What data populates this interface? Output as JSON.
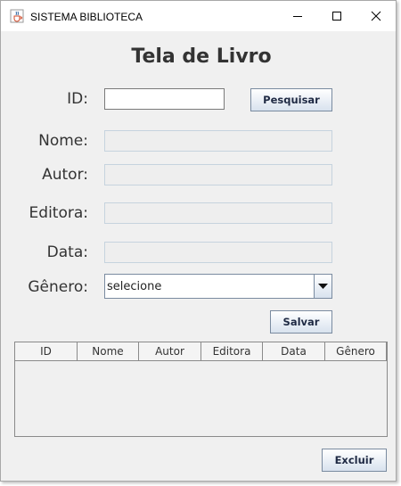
{
  "window": {
    "title": "SISTEMA BIBLIOTECA",
    "app_icon": "java-cup-icon",
    "controls": [
      "minimize-icon",
      "maximize-icon",
      "close-icon"
    ]
  },
  "form": {
    "heading": "Tela de Livro",
    "labels": {
      "id": "ID:",
      "nome": "Nome:",
      "autor": "Autor:",
      "editora": "Editora:",
      "data": "Data:",
      "genero": "Gênero:"
    },
    "values": {
      "id": "",
      "nome": "",
      "autor": "",
      "editora": "",
      "data": ""
    },
    "genero_selected": "selecione",
    "buttons": {
      "pesquisar": "Pesquisar",
      "salvar": "Salvar",
      "excluir": "Excluir"
    }
  },
  "table": {
    "columns": [
      "ID",
      "Nome",
      "Autor",
      "Editora",
      "Data",
      "Gênero"
    ],
    "rows": []
  }
}
